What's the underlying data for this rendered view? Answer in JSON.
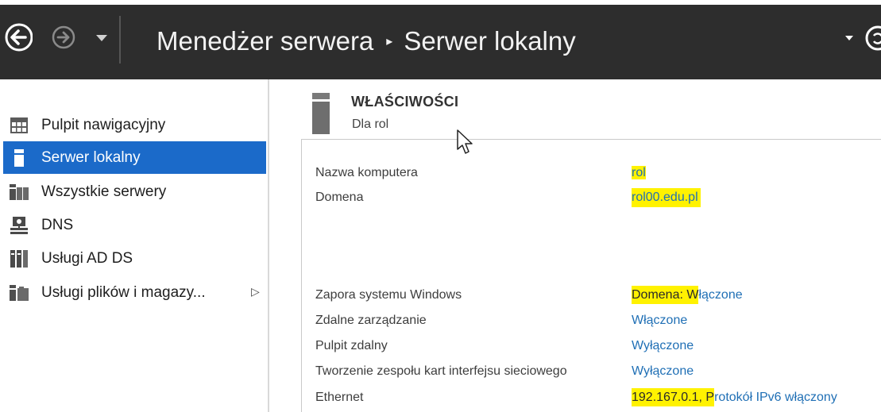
{
  "header": {
    "breadcrumb_root": "Menedżer serwera",
    "breadcrumb_sep": "▸",
    "breadcrumb_current": "Serwer lokalny"
  },
  "sidebar": {
    "items": [
      {
        "label": "Pulpit nawigacyjny",
        "icon": "dashboard-icon",
        "active": false
      },
      {
        "label": "Serwer lokalny",
        "icon": "local-server-icon",
        "active": true
      },
      {
        "label": "Wszystkie serwery",
        "icon": "all-servers-icon",
        "active": false
      },
      {
        "label": "DNS",
        "icon": "dns-icon",
        "active": false
      },
      {
        "label": "Usługi AD DS",
        "icon": "ad-ds-icon",
        "active": false
      },
      {
        "label": "Usługi plików i magazy...",
        "icon": "file-storage-icon",
        "active": false,
        "expand": "▷"
      }
    ]
  },
  "properties": {
    "title": "WŁAŚCIWOŚCI",
    "subtitle": "Dla rol",
    "rows": [
      {
        "label": "Nazwa komputera",
        "value": "rol"
      },
      {
        "label": "Domena",
        "value": "rol00.edu.pl"
      },
      {
        "label": "Zapora systemu Windows",
        "value_prefix": "Domena: W",
        "value_rest": "łączone"
      },
      {
        "label": "Zdalne zarządzanie",
        "value": "Włączone"
      },
      {
        "label": "Pulpit zdalny",
        "value": "Wyłączone"
      },
      {
        "label": "Tworzenie zespołu kart interfejsu sieciowego",
        "value": "Wyłączone"
      },
      {
        "label": "Ethernet",
        "value_prefix": "192.167.0.1, P",
        "value_rest": "rotokół IPv6 włączony"
      }
    ]
  },
  "colors": {
    "header_bg": "#2d2d2d",
    "active_bg": "#1b6ac9",
    "link": "#1f6fb5",
    "highlight": "#fff200"
  }
}
